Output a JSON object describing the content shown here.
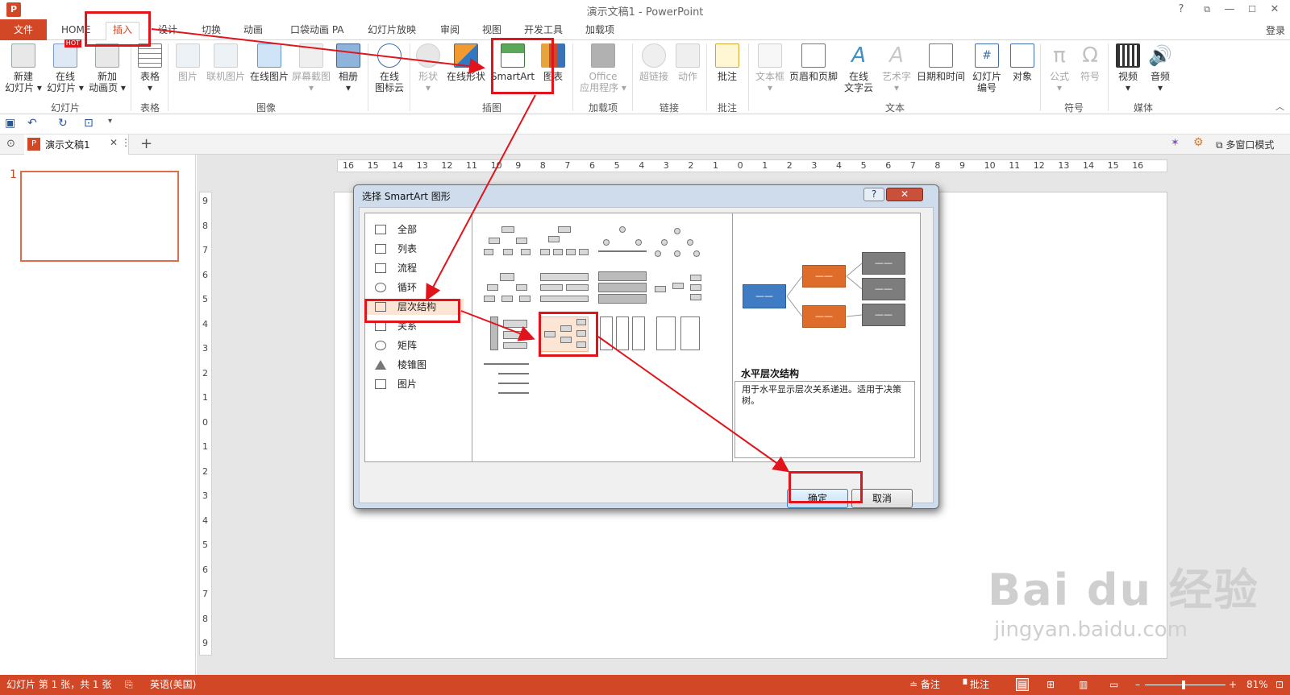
{
  "window": {
    "title": "演示文稿1 - PowerPoint",
    "help": "?",
    "restore": "⧉",
    "min": "—",
    "max": "☐",
    "close": "✕"
  },
  "tabs": {
    "file": "文件",
    "items": [
      "HOME",
      "插入",
      "设计",
      "切换",
      "动画",
      "口袋动画 PA",
      "幻灯片放映",
      "审阅",
      "视图",
      "开发工具",
      "加载项"
    ],
    "login": "登录"
  },
  "ribbon": {
    "buttons": [
      {
        "label": "新建\n幻灯片 ▾",
        "icon": "new-slide-icon"
      },
      {
        "label": "在线\n幻灯片 ▾",
        "icon": "online-slide-icon",
        "badge": "HOT"
      },
      {
        "label": "新加\n动画页 ▾",
        "icon": "add-animation-page-icon"
      },
      {
        "label": "表格\n▾",
        "icon": "table-icon"
      },
      {
        "label": "图片",
        "icon": "picture-icon"
      },
      {
        "label": "联机图片",
        "icon": "online-picture-icon"
      },
      {
        "label": "在线图片",
        "icon": "cloud-picture-icon"
      },
      {
        "label": "屏幕截图\n▾",
        "icon": "screenshot-icon"
      },
      {
        "label": "相册\n▾",
        "icon": "album-icon"
      },
      {
        "label": "在线\n图标云",
        "icon": "icon-cloud-icon"
      },
      {
        "label": "形状\n▾",
        "icon": "shapes-icon"
      },
      {
        "label": "在线形状",
        "icon": "online-shapes-icon"
      },
      {
        "label": "SmartArt",
        "icon": "smartart-icon"
      },
      {
        "label": "图表",
        "icon": "chart-icon"
      },
      {
        "label": "Office\n应用程序 ▾",
        "icon": "office-apps-icon"
      },
      {
        "label": "超链接",
        "icon": "hyperlink-icon"
      },
      {
        "label": "动作",
        "icon": "action-icon"
      },
      {
        "label": "批注",
        "icon": "comment-icon"
      },
      {
        "label": "文本框\n▾",
        "icon": "textbox-icon"
      },
      {
        "label": "页眉和页脚",
        "icon": "header-footer-icon"
      },
      {
        "label": "在线\n文字云",
        "icon": "word-cloud-icon"
      },
      {
        "label": "艺术字\n▾",
        "icon": "wordart-icon"
      },
      {
        "label": "日期和时间",
        "icon": "datetime-icon"
      },
      {
        "label": "幻灯片\n编号",
        "icon": "slide-number-icon"
      },
      {
        "label": "对象",
        "icon": "object-icon"
      },
      {
        "label": "公式\n▾",
        "icon": "equation-icon"
      },
      {
        "label": "符号",
        "icon": "symbol-icon"
      },
      {
        "label": "视频\n▾",
        "icon": "video-icon"
      },
      {
        "label": "音频\n▾",
        "icon": "audio-icon"
      }
    ],
    "groups": [
      "幻灯片",
      "表格",
      "图像",
      "插图",
      "加载项",
      "链接",
      "批注",
      "文本",
      "符号",
      "媒体"
    ]
  },
  "doc": {
    "tab_name": "演示文稿1",
    "multiwindow": "多窗口模式",
    "slide_number": "1"
  },
  "ruler": {
    "h": [
      "16",
      "15",
      "14",
      "13",
      "12",
      "11",
      "10",
      "9",
      "8",
      "7",
      "6",
      "5",
      "4",
      "3",
      "2",
      "1",
      "0",
      "1",
      "2",
      "3",
      "4",
      "5",
      "6",
      "7",
      "8",
      "9",
      "10",
      "11",
      "12",
      "13",
      "14",
      "15",
      "16"
    ],
    "v": [
      "9",
      "8",
      "7",
      "6",
      "5",
      "4",
      "3",
      "2",
      "1",
      "0",
      "1",
      "2",
      "3",
      "4",
      "5",
      "6",
      "7",
      "8",
      "9"
    ]
  },
  "dialog": {
    "title": "选择 SmartArt 图形",
    "categories": [
      "全部",
      "列表",
      "流程",
      "循环",
      "层次结构",
      "关系",
      "矩阵",
      "棱锥图",
      "图片"
    ],
    "selected_category": "层次结构",
    "preview_title": "水平层次结构",
    "preview_desc": "用于水平显示层次关系递进。适用于决策树。",
    "preview_box_text": "——",
    "ok": "确定",
    "cancel": "取消"
  },
  "status": {
    "slide_info": "幻灯片 第 1 张，共 1 张",
    "language": "英语(美国)",
    "notes": "备注",
    "comments": "批注",
    "zoom": "81%"
  },
  "watermark": {
    "logo": "Bai du 经验",
    "url": "jingyan.baidu.com"
  },
  "colors": {
    "accent": "#d24726",
    "annotation": "#e1141c",
    "preview_blue": "#3f7cc3",
    "preview_orange": "#de6c2a",
    "preview_gray": "#7d7d7d"
  }
}
